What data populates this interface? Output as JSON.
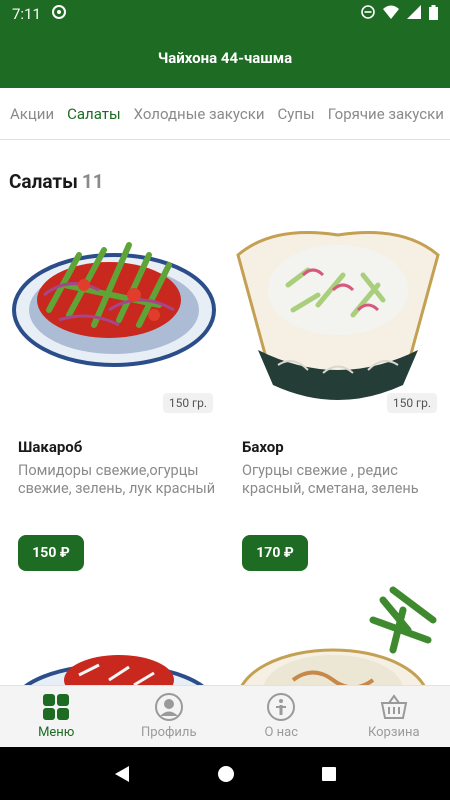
{
  "status": {
    "time": "7:11"
  },
  "app": {
    "title": "Чайхона 44-чашма"
  },
  "tabs": [
    {
      "label": "Акции",
      "active": false
    },
    {
      "label": "Салаты",
      "active": true
    },
    {
      "label": "Холодные закуски",
      "active": false
    },
    {
      "label": "Супы",
      "active": false
    },
    {
      "label": "Горячие закуски",
      "active": false
    }
  ],
  "section": {
    "title": "Салаты",
    "count": "11"
  },
  "items": [
    {
      "name": "Шакароб",
      "weight": "150 гр.",
      "description": "Помидоры свежие,огурцы свежие, зелень, лук красный",
      "price": "150 ₽"
    },
    {
      "name": "Бахор",
      "weight": "150 гр.",
      "description": "Огурцы свежие , редис красный, сметана, зелень",
      "price": "170 ₽"
    }
  ],
  "bottom_nav": [
    {
      "label": "Меню",
      "icon": "grid-icon",
      "active": true
    },
    {
      "label": "Профиль",
      "icon": "profile-icon",
      "active": false
    },
    {
      "label": "О нас",
      "icon": "info-icon",
      "active": false
    },
    {
      "label": "Корзина",
      "icon": "cart-icon",
      "active": false
    }
  ],
  "colors": {
    "primary": "#1e6b23",
    "muted": "#8a8a8a"
  }
}
